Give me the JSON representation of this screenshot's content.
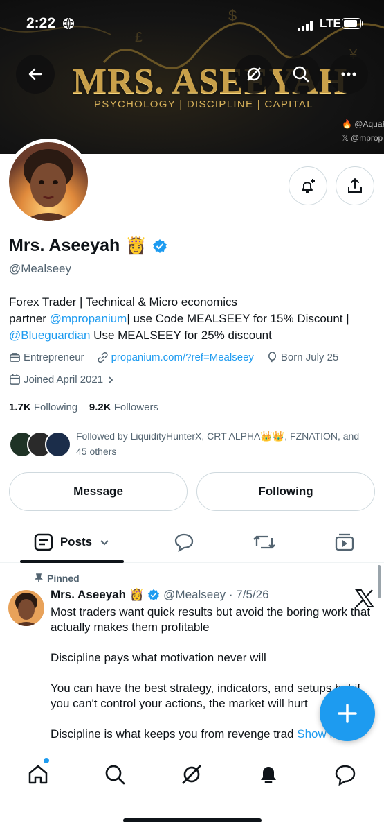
{
  "status_bar": {
    "time": "2:22",
    "network": "LTE"
  },
  "banner": {
    "title": "MRS. ASEEYAH",
    "subtitle": "PSYCHOLOGY | DISCIPLINE | CAPITAL",
    "handle_1": "@AquaF",
    "handle_2": "@mprop"
  },
  "profile": {
    "name": "Mrs. Aseeyah",
    "name_emoji": "👸",
    "handle": "@Mealseey",
    "bio": {
      "line1": "Forex Trader | Technical & Micro economics",
      "line2_a": "partner ",
      "line2_link": "@mpropanium",
      "line2_b": "| use Code MEALSEEY for 15% Discount |",
      "line3_link": "@Blueguardian",
      "line3_b": " Use MEALSEEY for 25% discount"
    },
    "category": "Entrepreneur",
    "website": "propanium.com/?ref=Mealseey",
    "born": "Born July 25",
    "joined": "Joined April 2021",
    "following_count": "1.7K",
    "following_label": "Following",
    "followers_count": "9.2K",
    "followers_label": "Followers",
    "followed_by_line1": "Followed by LiquidityHunterX, CRT ALPHA👑👑, FZNATION, and",
    "followed_by_line2": "45 others"
  },
  "actions": {
    "message": "Message",
    "following": "Following"
  },
  "tabs": {
    "posts": "Posts"
  },
  "post": {
    "pinned_label": "Pinned",
    "author": "Mrs. Aseeyah",
    "author_emoji": "👸",
    "handle_date": "@Mealseey · 7/5/26",
    "p1": "Most traders want quick results but avoid the boring work that actually makes them profitable",
    "p2": "Discipline pays what motivation never will",
    "p3": "You can have the best strategy, indicators, and setups but if you can't control your actions, the market will hurt",
    "p4": "Discipline is what keeps you from revenge trad",
    "show_more": "Show more"
  },
  "colors": {
    "accent": "#1d9bf0",
    "text": "#0f1419",
    "muted": "#536471",
    "gold": "#c9a04a"
  },
  "icons": [
    "back-arrow-icon",
    "grok-icon",
    "search-icon",
    "more-icon",
    "notification-bell-plus-icon",
    "share-icon",
    "briefcase-icon",
    "link-icon",
    "balloon-icon",
    "calendar-icon",
    "chevron-right-icon",
    "chevron-down-icon",
    "reply-icon",
    "repost-icon",
    "video-icon",
    "pin-icon",
    "x-logo-icon",
    "plus-icon",
    "home-icon",
    "bell-icon",
    "messages-icon"
  ]
}
